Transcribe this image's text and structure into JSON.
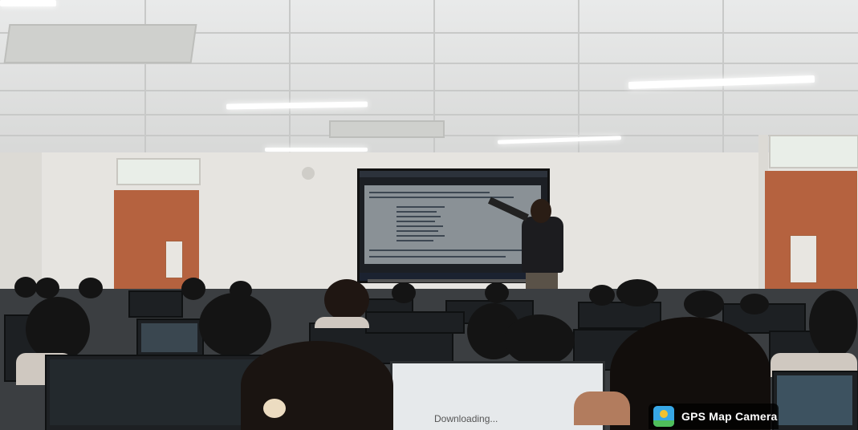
{
  "overlay": {
    "app_name": "GPS Map Camera",
    "icon": "gps-map-camera-icon"
  },
  "screens": {
    "front_status_text": "Downloading..."
  },
  "colors": {
    "badge_background": "#000000",
    "badge_text": "#ffffff",
    "door": "#b5623f",
    "wall": "#e6e4e0",
    "ceiling": "#e0e1e0"
  }
}
